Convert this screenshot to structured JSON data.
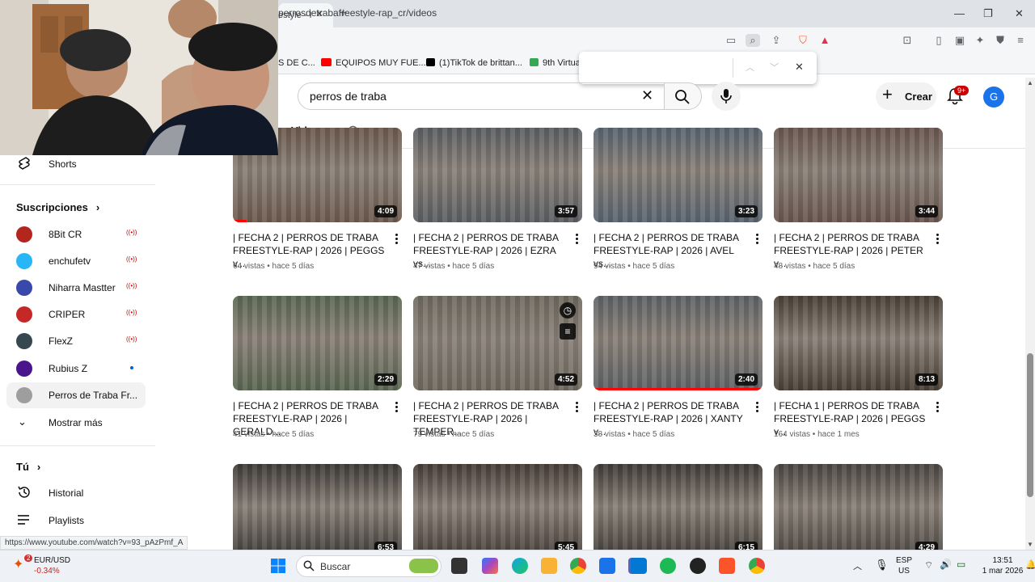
{
  "browser": {
    "tab_title": "estyle - I",
    "url": "perrosdetrabafreestyle-rap_cr/videos",
    "bookmarks": [
      {
        "label": "S DE C...",
        "icon": "bookmark-icon",
        "color": "#888888"
      },
      {
        "label": "EQUIPOS MUY FUE...",
        "icon": "youtube-icon",
        "color": "#ff0000"
      },
      {
        "label": "(1)TikTok de brittan...",
        "icon": "tiktok-icon",
        "color": "#000000"
      },
      {
        "label": "9th Virtua",
        "icon": "site-icon",
        "color": "#34a853"
      }
    ],
    "status_url": "https://www.youtube.com/watch?v=93_pAzPmf_A"
  },
  "header": {
    "search_value": "perros de traba",
    "create_label": "Crear",
    "notifications_badge": "9+",
    "avatar_letter": "G"
  },
  "channel_tabs": {
    "active": "Videos"
  },
  "sidebar": {
    "shorts_label": "Shorts",
    "subscriptions_heading": "Suscripciones",
    "subscriptions": [
      {
        "name": "8Bit CR",
        "status": "live",
        "color": "#b3261e"
      },
      {
        "name": "enchufetv",
        "status": "live",
        "color": "#29b6f6"
      },
      {
        "name": "Niharra Mastter",
        "status": "live",
        "color": "#3949ab"
      },
      {
        "name": "CRIPER",
        "status": "live",
        "color": "#c62828"
      },
      {
        "name": "FlexZ",
        "status": "live",
        "color": "#37474f"
      },
      {
        "name": "Rubius Z",
        "status": "new",
        "color": "#4a148c"
      },
      {
        "name": "Perros de Traba Fr...",
        "status": "active",
        "color": "#9e9e9e"
      }
    ],
    "show_more_label": "Mostrar más",
    "you_heading": "Tú",
    "you_items": [
      {
        "label": "Historial",
        "icon": "history-icon"
      },
      {
        "label": "Playlists",
        "icon": "playlist-icon"
      }
    ]
  },
  "videos": [
    {
      "title": "| FECHA 2 | PERROS DE TRABA FREESTYLE-RAP | 2026 | PEGGS v...",
      "meta": "64 vistas • hace 5 días",
      "duration": "4:09",
      "watched": 0.08,
      "hue": "#6d5a4e"
    },
    {
      "title": "| FECHA 2 | PERROS DE TRABA FREESTYLE-RAP | 2026 | EZRA vs...",
      "meta": "47 vistas • hace 5 días",
      "duration": "3:57",
      "watched": 0,
      "hue": "#5c5f63"
    },
    {
      "title": "| FECHA 2 | PERROS DE TRABA FREESTYLE-RAP | 2026 | AVEL vs...",
      "meta": "94 vistas • hace 5 días",
      "duration": "3:23",
      "watched": 0,
      "hue": "#596470"
    },
    {
      "title": "| FECHA 2 | PERROS DE TRABA FREESTYLE-RAP | 2026 | PETER v...",
      "meta": "48 vistas • hace 5 días",
      "duration": "3:44",
      "watched": 0,
      "hue": "#6a5650"
    },
    {
      "title": "| FECHA 2 | PERROS DE TRABA FREESTYLE-RAP | 2026 | GERALD...",
      "meta": "41 vistas • hace 5 días",
      "duration": "2:29",
      "watched": 0,
      "hue": "#5b6752"
    },
    {
      "title": "| FECHA 2 | PERROS DE TRABA FREESTYLE-RAP | 2026 | TEMPER...",
      "meta": "79 vistas • hace 5 días",
      "duration": "4:52",
      "watched": 0,
      "hue": "#6f6a60"
    },
    {
      "title": "| FECHA 2 | PERROS DE TRABA FREESTYLE-RAP | 2026 | XANTY v...",
      "meta": "38 vistas • hace 5 días",
      "duration": "2:40",
      "watched": 1.0,
      "hue": "#5e6266"
    },
    {
      "title": "| FECHA 1 | PERROS DE TRABA FREESTYLE-RAP | 2026 | PEGGS v...",
      "meta": "164 vistas • hace 1 mes",
      "duration": "8:13",
      "watched": 0,
      "hue": "#4a4136"
    },
    {
      "title": "",
      "meta": "",
      "duration": "6:53",
      "watched": 0,
      "hue": "#3d3a38"
    },
    {
      "title": "",
      "meta": "",
      "duration": "5:45",
      "watched": 0,
      "hue": "#463c37"
    },
    {
      "title": "",
      "meta": "",
      "duration": "6:15",
      "watched": 0,
      "hue": "#3f3b36"
    },
    {
      "title": "",
      "meta": "",
      "duration": "4:29",
      "watched": 0,
      "hue": "#4a4540"
    }
  ],
  "taskbar": {
    "ticker_label": "EUR/USD",
    "ticker_change": "-0.34%",
    "weather_badge": "2",
    "search_label": "Buscar",
    "language": "ESP",
    "region": "US",
    "time": "13:51",
    "date": "1 mar 2026"
  }
}
